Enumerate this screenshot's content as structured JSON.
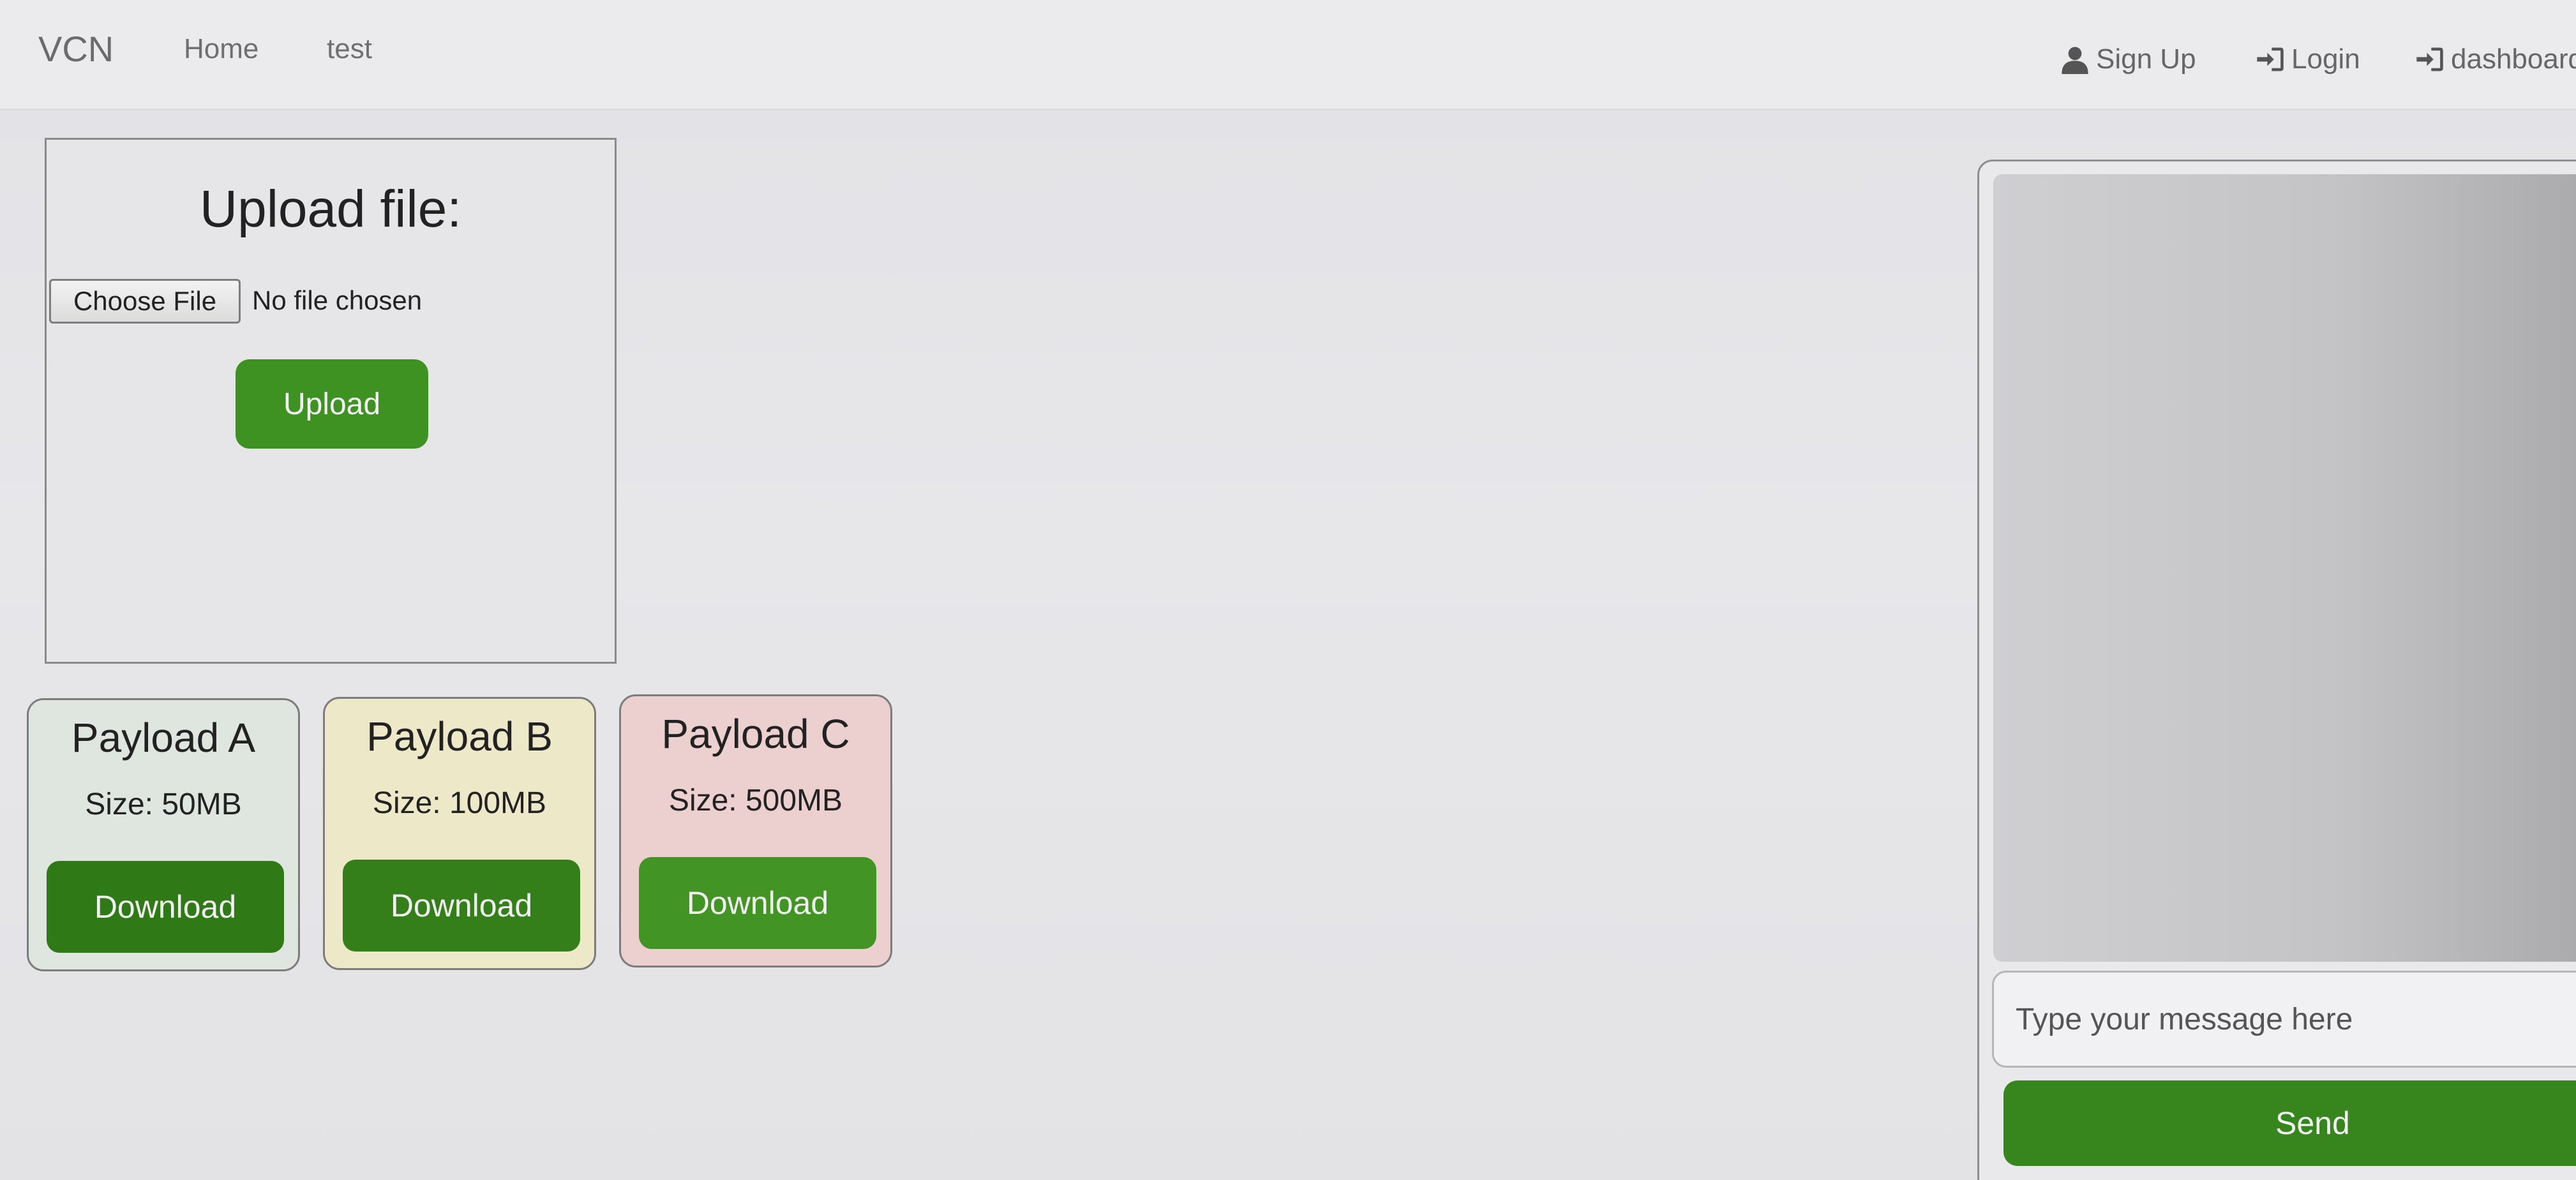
{
  "navbar": {
    "brand": "VCN",
    "links": [
      "Home",
      "test"
    ],
    "right": [
      {
        "label": "Sign Up",
        "icon": "user-icon"
      },
      {
        "label": "Login",
        "icon": "login-icon"
      },
      {
        "label": "dashboard",
        "icon": "login-icon"
      }
    ]
  },
  "upload": {
    "title": "Upload file:",
    "choose_label": "Choose File",
    "file_status": "No file chosen",
    "button_label": "Upload"
  },
  "payloads": [
    {
      "title": "Payload A",
      "size": "Size: 50MB",
      "button": "Download",
      "bg": "#dfe5df",
      "btn_color": "#2f7a17"
    },
    {
      "title": "Payload B",
      "size": "Size: 100MB",
      "button": "Download",
      "bg": "#ece8c8",
      "btn_color": "#357f1b"
    },
    {
      "title": "Payload C",
      "size": "Size: 500MB",
      "button": "Download",
      "bg": "#ecd0d0",
      "btn_color": "#429424"
    }
  ],
  "chat": {
    "placeholder": "Type your message here",
    "send_label": "Send"
  },
  "colors": {
    "accent_green": "#3e9222"
  }
}
